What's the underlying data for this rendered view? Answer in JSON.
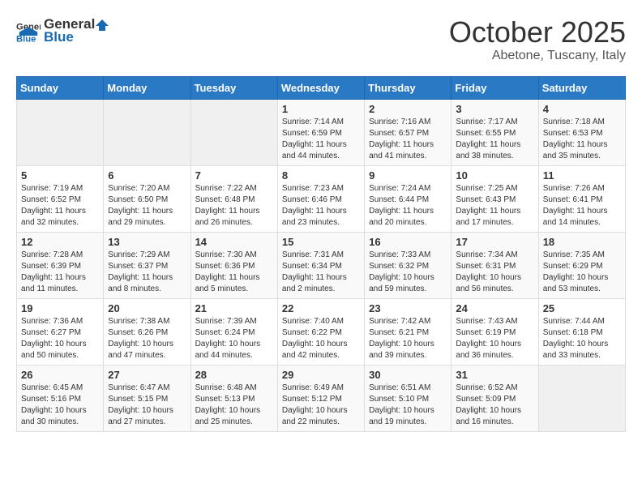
{
  "logo": {
    "general": "General",
    "blue": "Blue"
  },
  "header": {
    "month": "October 2025",
    "location": "Abetone, Tuscany, Italy"
  },
  "weekdays": [
    "Sunday",
    "Monday",
    "Tuesday",
    "Wednesday",
    "Thursday",
    "Friday",
    "Saturday"
  ],
  "weeks": [
    [
      {
        "day": "",
        "sunrise": "",
        "sunset": "",
        "daylight": ""
      },
      {
        "day": "",
        "sunrise": "",
        "sunset": "",
        "daylight": ""
      },
      {
        "day": "",
        "sunrise": "",
        "sunset": "",
        "daylight": ""
      },
      {
        "day": "1",
        "sunrise": "Sunrise: 7:14 AM",
        "sunset": "Sunset: 6:59 PM",
        "daylight": "Daylight: 11 hours and 44 minutes."
      },
      {
        "day": "2",
        "sunrise": "Sunrise: 7:16 AM",
        "sunset": "Sunset: 6:57 PM",
        "daylight": "Daylight: 11 hours and 41 minutes."
      },
      {
        "day": "3",
        "sunrise": "Sunrise: 7:17 AM",
        "sunset": "Sunset: 6:55 PM",
        "daylight": "Daylight: 11 hours and 38 minutes."
      },
      {
        "day": "4",
        "sunrise": "Sunrise: 7:18 AM",
        "sunset": "Sunset: 6:53 PM",
        "daylight": "Daylight: 11 hours and 35 minutes."
      }
    ],
    [
      {
        "day": "5",
        "sunrise": "Sunrise: 7:19 AM",
        "sunset": "Sunset: 6:52 PM",
        "daylight": "Daylight: 11 hours and 32 minutes."
      },
      {
        "day": "6",
        "sunrise": "Sunrise: 7:20 AM",
        "sunset": "Sunset: 6:50 PM",
        "daylight": "Daylight: 11 hours and 29 minutes."
      },
      {
        "day": "7",
        "sunrise": "Sunrise: 7:22 AM",
        "sunset": "Sunset: 6:48 PM",
        "daylight": "Daylight: 11 hours and 26 minutes."
      },
      {
        "day": "8",
        "sunrise": "Sunrise: 7:23 AM",
        "sunset": "Sunset: 6:46 PM",
        "daylight": "Daylight: 11 hours and 23 minutes."
      },
      {
        "day": "9",
        "sunrise": "Sunrise: 7:24 AM",
        "sunset": "Sunset: 6:44 PM",
        "daylight": "Daylight: 11 hours and 20 minutes."
      },
      {
        "day": "10",
        "sunrise": "Sunrise: 7:25 AM",
        "sunset": "Sunset: 6:43 PM",
        "daylight": "Daylight: 11 hours and 17 minutes."
      },
      {
        "day": "11",
        "sunrise": "Sunrise: 7:26 AM",
        "sunset": "Sunset: 6:41 PM",
        "daylight": "Daylight: 11 hours and 14 minutes."
      }
    ],
    [
      {
        "day": "12",
        "sunrise": "Sunrise: 7:28 AM",
        "sunset": "Sunset: 6:39 PM",
        "daylight": "Daylight: 11 hours and 11 minutes."
      },
      {
        "day": "13",
        "sunrise": "Sunrise: 7:29 AM",
        "sunset": "Sunset: 6:37 PM",
        "daylight": "Daylight: 11 hours and 8 minutes."
      },
      {
        "day": "14",
        "sunrise": "Sunrise: 7:30 AM",
        "sunset": "Sunset: 6:36 PM",
        "daylight": "Daylight: 11 hours and 5 minutes."
      },
      {
        "day": "15",
        "sunrise": "Sunrise: 7:31 AM",
        "sunset": "Sunset: 6:34 PM",
        "daylight": "Daylight: 11 hours and 2 minutes."
      },
      {
        "day": "16",
        "sunrise": "Sunrise: 7:33 AM",
        "sunset": "Sunset: 6:32 PM",
        "daylight": "Daylight: 10 hours and 59 minutes."
      },
      {
        "day": "17",
        "sunrise": "Sunrise: 7:34 AM",
        "sunset": "Sunset: 6:31 PM",
        "daylight": "Daylight: 10 hours and 56 minutes."
      },
      {
        "day": "18",
        "sunrise": "Sunrise: 7:35 AM",
        "sunset": "Sunset: 6:29 PM",
        "daylight": "Daylight: 10 hours and 53 minutes."
      }
    ],
    [
      {
        "day": "19",
        "sunrise": "Sunrise: 7:36 AM",
        "sunset": "Sunset: 6:27 PM",
        "daylight": "Daylight: 10 hours and 50 minutes."
      },
      {
        "day": "20",
        "sunrise": "Sunrise: 7:38 AM",
        "sunset": "Sunset: 6:26 PM",
        "daylight": "Daylight: 10 hours and 47 minutes."
      },
      {
        "day": "21",
        "sunrise": "Sunrise: 7:39 AM",
        "sunset": "Sunset: 6:24 PM",
        "daylight": "Daylight: 10 hours and 44 minutes."
      },
      {
        "day": "22",
        "sunrise": "Sunrise: 7:40 AM",
        "sunset": "Sunset: 6:22 PM",
        "daylight": "Daylight: 10 hours and 42 minutes."
      },
      {
        "day": "23",
        "sunrise": "Sunrise: 7:42 AM",
        "sunset": "Sunset: 6:21 PM",
        "daylight": "Daylight: 10 hours and 39 minutes."
      },
      {
        "day": "24",
        "sunrise": "Sunrise: 7:43 AM",
        "sunset": "Sunset: 6:19 PM",
        "daylight": "Daylight: 10 hours and 36 minutes."
      },
      {
        "day": "25",
        "sunrise": "Sunrise: 7:44 AM",
        "sunset": "Sunset: 6:18 PM",
        "daylight": "Daylight: 10 hours and 33 minutes."
      }
    ],
    [
      {
        "day": "26",
        "sunrise": "Sunrise: 6:45 AM",
        "sunset": "Sunset: 5:16 PM",
        "daylight": "Daylight: 10 hours and 30 minutes."
      },
      {
        "day": "27",
        "sunrise": "Sunrise: 6:47 AM",
        "sunset": "Sunset: 5:15 PM",
        "daylight": "Daylight: 10 hours and 27 minutes."
      },
      {
        "day": "28",
        "sunrise": "Sunrise: 6:48 AM",
        "sunset": "Sunset: 5:13 PM",
        "daylight": "Daylight: 10 hours and 25 minutes."
      },
      {
        "day": "29",
        "sunrise": "Sunrise: 6:49 AM",
        "sunset": "Sunset: 5:12 PM",
        "daylight": "Daylight: 10 hours and 22 minutes."
      },
      {
        "day": "30",
        "sunrise": "Sunrise: 6:51 AM",
        "sunset": "Sunset: 5:10 PM",
        "daylight": "Daylight: 10 hours and 19 minutes."
      },
      {
        "day": "31",
        "sunrise": "Sunrise: 6:52 AM",
        "sunset": "Sunset: 5:09 PM",
        "daylight": "Daylight: 10 hours and 16 minutes."
      },
      {
        "day": "",
        "sunrise": "",
        "sunset": "",
        "daylight": ""
      }
    ]
  ]
}
